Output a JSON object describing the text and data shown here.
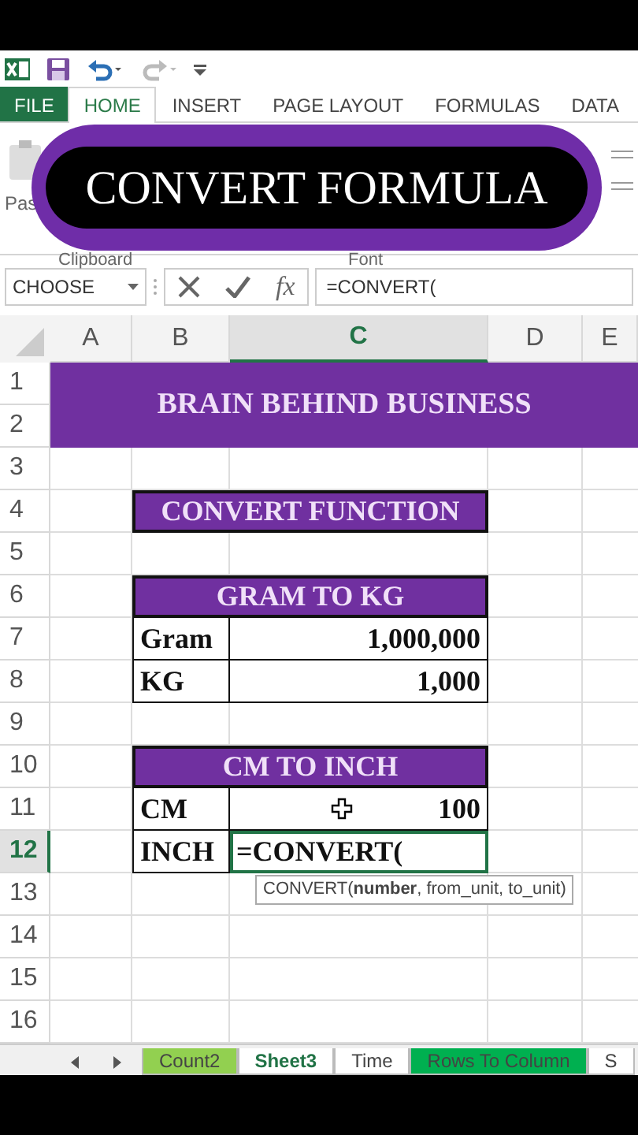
{
  "ribbon_tabs": [
    {
      "label": "FILE",
      "kind": "file",
      "selected": false
    },
    {
      "label": "HOME",
      "kind": "tab",
      "selected": true
    },
    {
      "label": "INSERT",
      "kind": "tab",
      "selected": false
    },
    {
      "label": "PAGE LAYOUT",
      "kind": "tab",
      "selected": false
    },
    {
      "label": "FORMULAS",
      "kind": "tab",
      "selected": false
    },
    {
      "label": "DATA",
      "kind": "tab",
      "selected": false
    }
  ],
  "ribbon": {
    "paste_label": "Pas",
    "groups": [
      "Clipboard",
      "Font"
    ]
  },
  "overlay_title": "CONVERT FORMULA",
  "formula_bar": {
    "name_box": "CHOOSE",
    "fx": "fx",
    "formula": "=CONVERT("
  },
  "columns": [
    {
      "label": "A",
      "selected": false
    },
    {
      "label": "B",
      "selected": false
    },
    {
      "label": "C",
      "selected": true
    },
    {
      "label": "D",
      "selected": false
    },
    {
      "label": "E",
      "selected": false
    }
  ],
  "rows": [
    {
      "label": "1",
      "selected": false
    },
    {
      "label": "2",
      "selected": false
    },
    {
      "label": "3",
      "selected": false
    },
    {
      "label": "4",
      "selected": false
    },
    {
      "label": "5",
      "selected": false
    },
    {
      "label": "6",
      "selected": false
    },
    {
      "label": "7",
      "selected": false
    },
    {
      "label": "8",
      "selected": false
    },
    {
      "label": "9",
      "selected": false
    },
    {
      "label": "10",
      "selected": false
    },
    {
      "label": "11",
      "selected": false
    },
    {
      "label": "12",
      "selected": true
    },
    {
      "label": "13",
      "selected": false
    },
    {
      "label": "14",
      "selected": false
    },
    {
      "label": "15",
      "selected": false
    },
    {
      "label": "16",
      "selected": false
    }
  ],
  "banner": {
    "text": "BRAIN BEHIND BUSINESS"
  },
  "tables": [
    {
      "header": "CONVERT FUNCTION"
    },
    {
      "header": "GRAM TO KG",
      "rows": [
        {
          "label": "Gram",
          "value": "1,000,000",
          "active": false
        },
        {
          "label": "KG",
          "value": "1,000",
          "active": false
        }
      ]
    },
    {
      "header": "CM TO INCH",
      "rows": [
        {
          "label": "CM",
          "value": "100",
          "active": false,
          "cursor": true
        },
        {
          "label": "INCH",
          "value": "=CONVERT(",
          "active": true,
          "cursor": false
        }
      ]
    }
  ],
  "tooltip": "CONVERT(**number**, from_unit, to_unit)",
  "sheet_tabs": [
    {
      "label": "Count2",
      "selected": false,
      "color": "#92d050"
    },
    {
      "label": "Sheet3",
      "selected": true
    },
    {
      "label": "Time",
      "selected": false
    },
    {
      "label": "Rows To Column",
      "selected": false,
      "color": "#00b050"
    },
    {
      "label": "S",
      "selected": false
    }
  ]
}
